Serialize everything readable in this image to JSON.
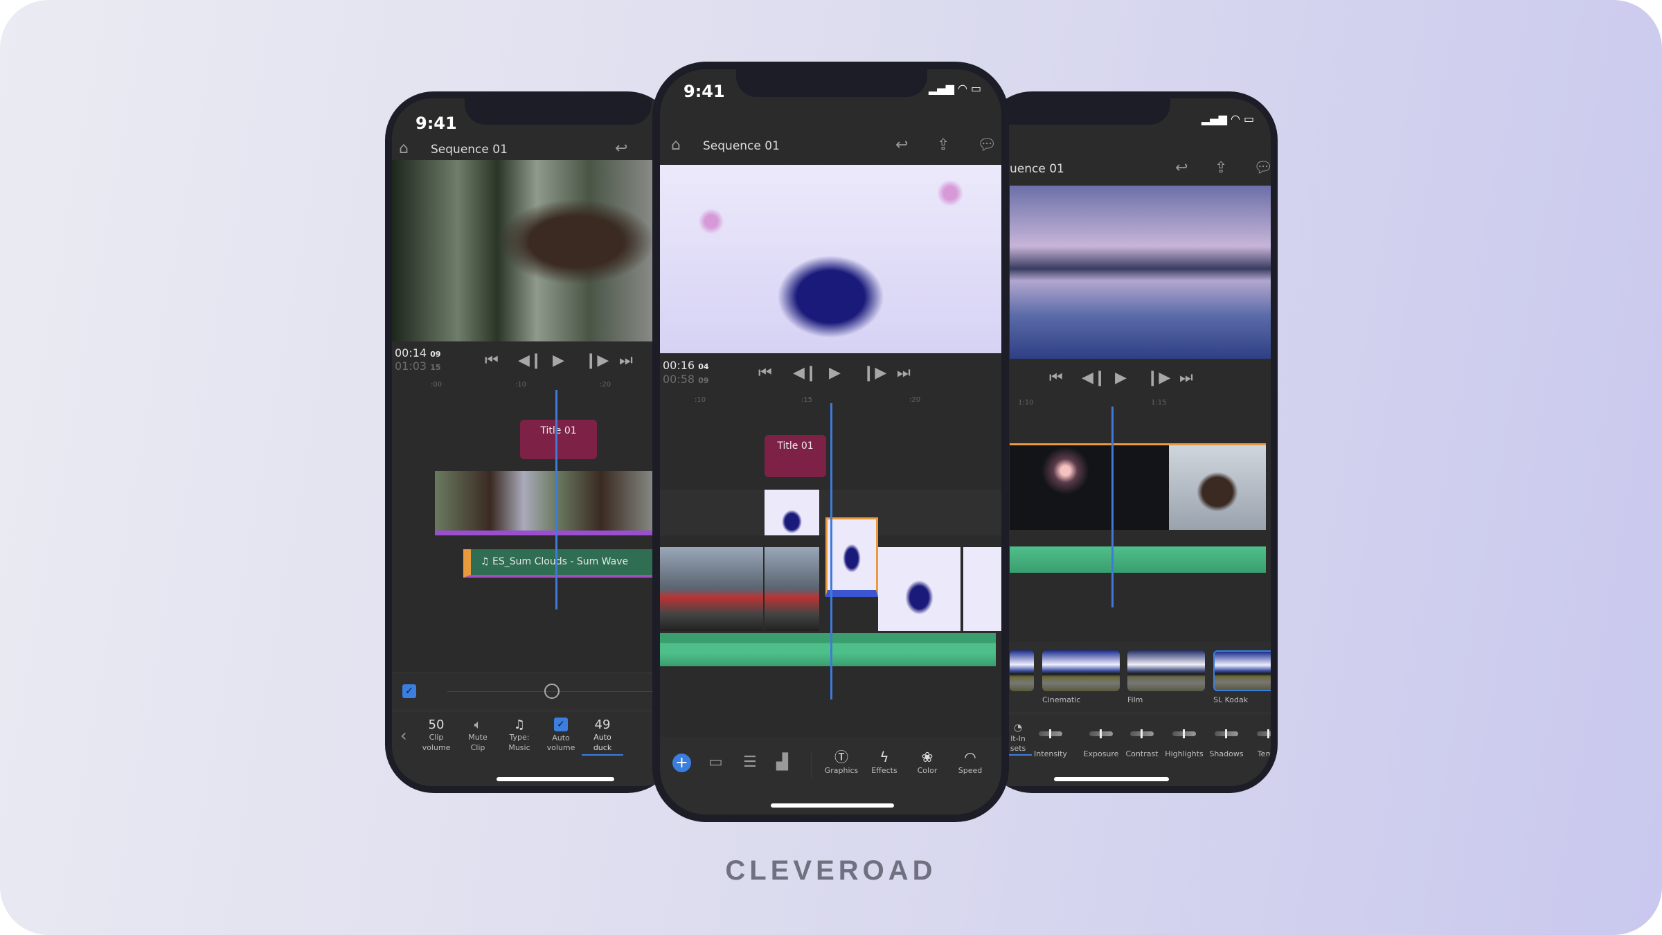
{
  "brand": {
    "logo_text": "CLEVEROAD"
  },
  "colors": {
    "accent": "#3b7ee0",
    "title_clip": "#7d2246",
    "audio_clip": "#2f6e52",
    "selection": "#e89a3c",
    "background": "#d8d8ef"
  },
  "left_phone": {
    "status_time": "9:41",
    "header": {
      "title": "Sequence 01",
      "icons": [
        "home-icon",
        "undo-icon"
      ]
    },
    "timecode": {
      "current": "00:14",
      "current_frames": "09",
      "total": "01:03",
      "total_frames": "15"
    },
    "ruler": [
      ":00",
      ":10",
      ":20"
    ],
    "title_clip": "Title 01",
    "audio_clip": "ES_Sum Clouds - Sum Wave",
    "audio_panel": {
      "slider_checked": true,
      "items": [
        {
          "value": "50",
          "label1": "Clip",
          "label2": "volume"
        },
        {
          "icon": "speaker-icon",
          "label1": "Mute",
          "label2": "Clip"
        },
        {
          "icon": "music-note-icon",
          "label1": "Type:",
          "label2": "Music"
        },
        {
          "icon": "checkbox-checked-icon",
          "label1": "Auto",
          "label2": "volume"
        },
        {
          "value": "49",
          "label1": "Auto",
          "label2": "duck",
          "active": true
        }
      ]
    }
  },
  "center_phone": {
    "status_time": "9:41",
    "header": {
      "title": "Sequence 01",
      "icons": [
        "home-icon",
        "undo-icon",
        "share-icon",
        "comment-icon"
      ]
    },
    "timecode": {
      "current": "00:16",
      "current_frames": "04",
      "total": "00:58",
      "total_frames": "09"
    },
    "ruler": [
      ":10",
      ":15",
      ":20"
    ],
    "title_clip": "Title 01",
    "toolbar": {
      "icons": [
        "add-icon",
        "archive-icon",
        "align-icon",
        "layers-icon"
      ],
      "tools": [
        {
          "icon": "graphics-icon",
          "label": "Graphics"
        },
        {
          "icon": "effects-icon",
          "label": "Effects"
        },
        {
          "icon": "color-icon",
          "label": "Color"
        },
        {
          "icon": "speed-icon",
          "label": "Speed"
        }
      ]
    }
  },
  "right_phone": {
    "header": {
      "title": "uence 01",
      "icons": [
        "undo-icon",
        "share-icon",
        "comment-icon"
      ]
    },
    "ruler": [
      "1:10",
      "1:15"
    ],
    "presets": [
      {
        "label": ""
      },
      {
        "label": "Cinematic"
      },
      {
        "label": "Film"
      },
      {
        "label": "SL Kodak",
        "selected": true
      }
    ],
    "adjustments": {
      "partial_tab1": "lt-In",
      "partial_tab2": "sets",
      "items": [
        "Intensity",
        "Exposure",
        "Contrast",
        "Highlights",
        "Shadows",
        "Tem"
      ]
    }
  }
}
